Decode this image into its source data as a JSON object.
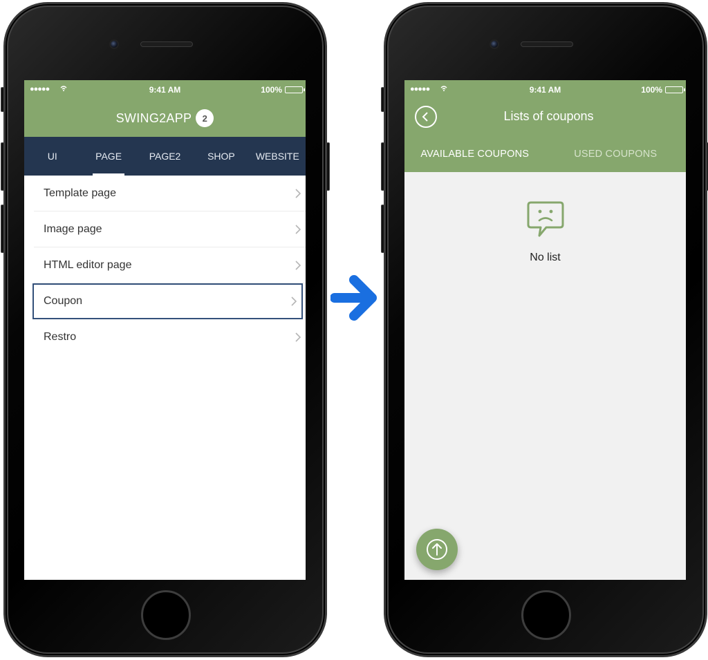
{
  "status": {
    "time": "9:41 AM",
    "battery": "100%",
    "signal": "●●●●●"
  },
  "left_phone": {
    "app_title": "SWING2APP",
    "badge_count": "2",
    "tabs": [
      {
        "label": "UI",
        "active": false
      },
      {
        "label": "PAGE",
        "active": true
      },
      {
        "label": "PAGE2",
        "active": false
      },
      {
        "label": "SHOP",
        "active": false
      },
      {
        "label": "WEBSITE",
        "active": false
      }
    ],
    "menu_items": [
      {
        "label": "Template page"
      },
      {
        "label": "Image page"
      },
      {
        "label": "HTML editor page"
      },
      {
        "label": "Coupon",
        "selected": true
      },
      {
        "label": "Restro"
      }
    ]
  },
  "right_phone": {
    "title": "Lists of coupons",
    "tabs": [
      {
        "label": "AVAILABLE COUPONS",
        "active": true
      },
      {
        "label": "USED COUPONS",
        "active": false
      }
    ],
    "empty_label": "No list",
    "fab_icon": "upload-arrow-icon"
  },
  "colors": {
    "accent_green": "#86a76d",
    "tab_bar_navy": "#243650",
    "selection_border": "#33507a",
    "arrow_blue": "#1a6fe0"
  }
}
